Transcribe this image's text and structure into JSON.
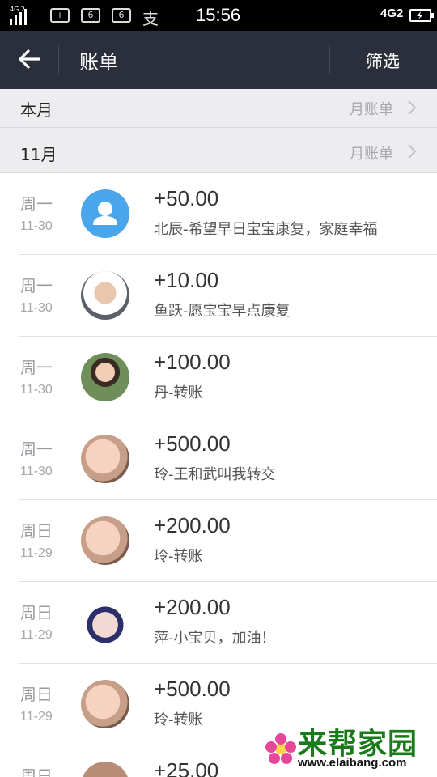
{
  "status_bar": {
    "signal_tag": "4G 2",
    "icons": [
      "sim-plus-icon",
      "sim-6-icon",
      "sim-6b-icon",
      "alipay-icon"
    ],
    "icon_text": [
      "+",
      "6",
      "6"
    ],
    "alipay_char": "支",
    "time": "15:56",
    "network": "4G2"
  },
  "nav": {
    "title": "账单",
    "filter_label": "筛选"
  },
  "sections": [
    {
      "label": "本月",
      "link": "月账单"
    },
    {
      "label": "11月",
      "link": "月账单"
    }
  ],
  "transactions": [
    {
      "weekday": "周一",
      "date": "11-30",
      "amount": "+50.00",
      "note": "北辰-希望早日宝宝康复，家庭幸福"
    },
    {
      "weekday": "周一",
      "date": "11-30",
      "amount": "+10.00",
      "note": "鱼跃-愿宝宝早点康复"
    },
    {
      "weekday": "周一",
      "date": "11-30",
      "amount": "+100.00",
      "note": "丹-转账"
    },
    {
      "weekday": "周一",
      "date": "11-30",
      "amount": "+500.00",
      "note": "玲-王和武叫我转交"
    },
    {
      "weekday": "周日",
      "date": "11-29",
      "amount": "+200.00",
      "note": "玲-转账"
    },
    {
      "weekday": "周日",
      "date": "11-29",
      "amount": "+200.00",
      "note": "萍-小宝贝，加油！"
    },
    {
      "weekday": "周日",
      "date": "11-29",
      "amount": "+500.00",
      "note": "玲-转账"
    },
    {
      "weekday": "周日",
      "date": "",
      "amount": "+25.00",
      "note": ""
    }
  ],
  "watermark": {
    "title": "来帮家园",
    "url": "www.elaibang.com"
  },
  "colors": {
    "nav_bg": "#2b2f3b",
    "section_bg": "#ededf0",
    "default_avatar": "#4aa6ea"
  }
}
